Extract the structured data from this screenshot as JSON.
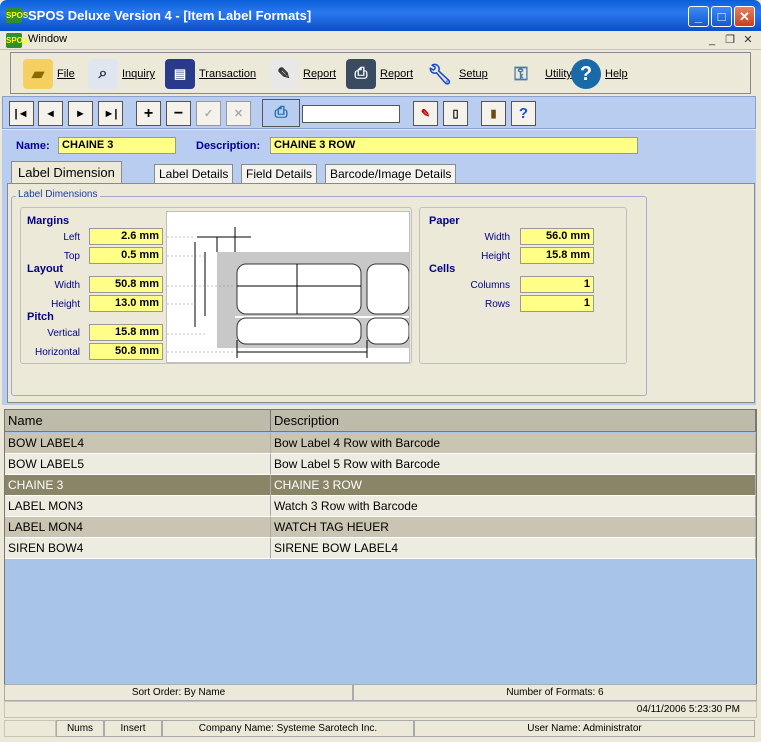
{
  "window": {
    "title": "SPOS Deluxe Version 4 - [Item Label Formats]",
    "icon_text": "SPOS"
  },
  "menu": {
    "window_label": "Window"
  },
  "toolbar": [
    {
      "label": "File",
      "icon": "folder-icon"
    },
    {
      "label": "Inquiry",
      "icon": "magnifier-icon"
    },
    {
      "label": "Transaction",
      "icon": "document-icon"
    },
    {
      "label": "Report",
      "icon": "report-pen-icon"
    },
    {
      "label": "Report",
      "icon": "printer-icon"
    },
    {
      "label": "Setup",
      "icon": "wrench-icon"
    },
    {
      "label": "Utility",
      "icon": "keys-icon"
    },
    {
      "label": "Help",
      "icon": "help-icon"
    }
  ],
  "nav": {
    "first": "|◄",
    "prev": "◄",
    "next": "►",
    "last": "►|",
    "add": "+",
    "remove": "−",
    "confirm": "✓",
    "cancel": "✕",
    "help": "?",
    "search_value": ""
  },
  "form": {
    "name_label": "Name:",
    "name_value": "CHAINE 3",
    "desc_label": "Description:",
    "desc_value": "CHAINE 3 ROW"
  },
  "tabs": [
    "Label Dimension",
    "Label Details",
    "Field Details",
    "Barcode/Image Details"
  ],
  "dimensions": {
    "group_label": "Label Dimensions",
    "margins": {
      "title": "Margins",
      "left_label": "Left",
      "left": "2.6 mm",
      "top_label": "Top",
      "top": "0.5 mm"
    },
    "layout": {
      "title": "Layout",
      "width_label": "Width",
      "width": "50.8 mm",
      "height_label": "Height",
      "height": "13.0 mm"
    },
    "pitch": {
      "title": "Pitch",
      "vertical_label": "Vertical",
      "vertical": "15.8 mm",
      "horizontal_label": "Horizontal",
      "horizontal": "50.8 mm"
    },
    "paper": {
      "title": "Paper",
      "width_label": "Width",
      "width": "56.0 mm",
      "height_label": "Height",
      "height": "15.8 mm"
    },
    "cells": {
      "title": "Cells",
      "columns_label": "Columns",
      "columns": "1",
      "rows_label": "Rows",
      "rows": "1"
    }
  },
  "list": {
    "headers": [
      "Name",
      "Description"
    ],
    "rows": [
      {
        "name": "BOW LABEL4",
        "description": "Bow Label 4 Row with Barcode"
      },
      {
        "name": "BOW LABEL5",
        "description": "Bow Label 5 Row  with Barcode"
      },
      {
        "name": "CHAINE 3",
        "description": "CHAINE 3 ROW",
        "selected": true
      },
      {
        "name": "LABEL MON3",
        "description": "Watch 3 Row with Barcode"
      },
      {
        "name": "LABEL MON4",
        "description": "WATCH TAG HEUER"
      },
      {
        "name": "SIREN BOW4",
        "description": "SIRENE BOW LABEL4"
      }
    ]
  },
  "status": {
    "sort_order": "Sort Order: By Name",
    "count": "Number of Formats: 6",
    "datetime": "04/11/2006  5:23:30 PM",
    "nums": "Nums",
    "insert": "Insert",
    "company": "Company Name: Systeme Sarotech Inc.",
    "user": "User Name: Administrator"
  },
  "colors": {
    "accent": "#0a5fd8",
    "field_yellow": "#ffff88",
    "selected_row": "#8a8566",
    "row_even": "#c9c5b2",
    "row_odd": "#eeece0",
    "panel_blue": "#b8cdf0"
  }
}
